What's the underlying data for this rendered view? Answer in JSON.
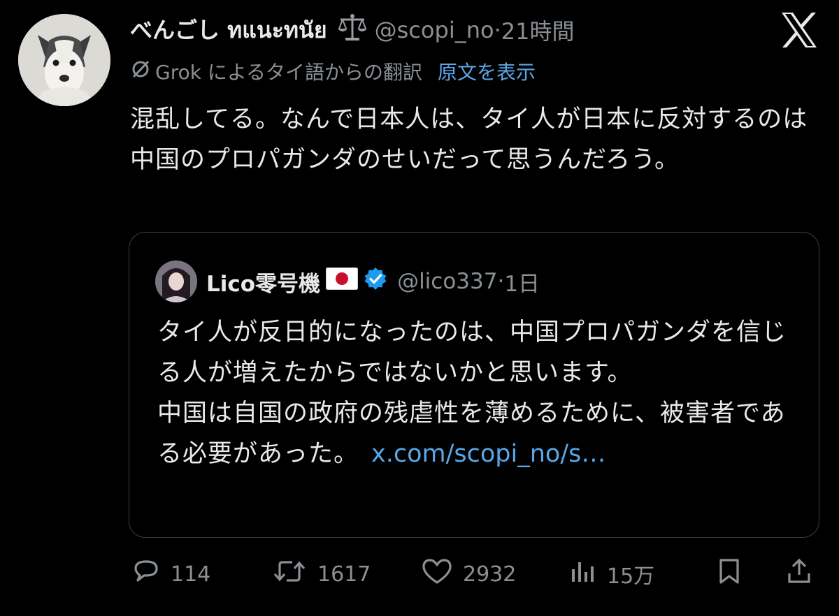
{
  "tweet": {
    "display_name": "べんごし ทแนะทนัย",
    "handle": "@scopi_no",
    "separator": "·",
    "time": "21時間",
    "translation_note": "Grok によるタイ語からの翻訳",
    "show_original_label": "原文を表示",
    "text": "混乱してる。なんで日本人は、タイ人が日本に反対するのは中国のプロパガンダのせいだって思うんだろう。"
  },
  "quote": {
    "display_name": "Lico零号機",
    "handle": "@lico337",
    "separator": "·",
    "time": "1日",
    "text_paragraph_1": "タイ人が反日的になったのは、中国プロパガンダを信じる人が増えたからではないかと思います。",
    "text_paragraph_2": "中国は自国の政府の残虐性を薄めるために、被害者である必要があった。",
    "link": "x.com/scopi_no/s…"
  },
  "actions": {
    "replies": "114",
    "reposts": "1617",
    "likes": "2932",
    "views": "15万"
  },
  "icons": {
    "brand": "x-logo-icon",
    "emoji": "balance-scale-icon",
    "translate": "no-translation-icon",
    "flag": "japan-flag-icon",
    "verified": "verified-badge-icon",
    "reply": "reply-icon",
    "repost": "repost-icon",
    "like": "heart-icon",
    "views": "views-icon",
    "bookmark": "bookmark-icon",
    "share": "share-icon"
  },
  "colors": {
    "background": "#000000",
    "text": "#e7e9ea",
    "muted": "#8b9095",
    "link": "#5aa7e8",
    "verified": "#1d9bf0",
    "border": "#3a3d41"
  }
}
